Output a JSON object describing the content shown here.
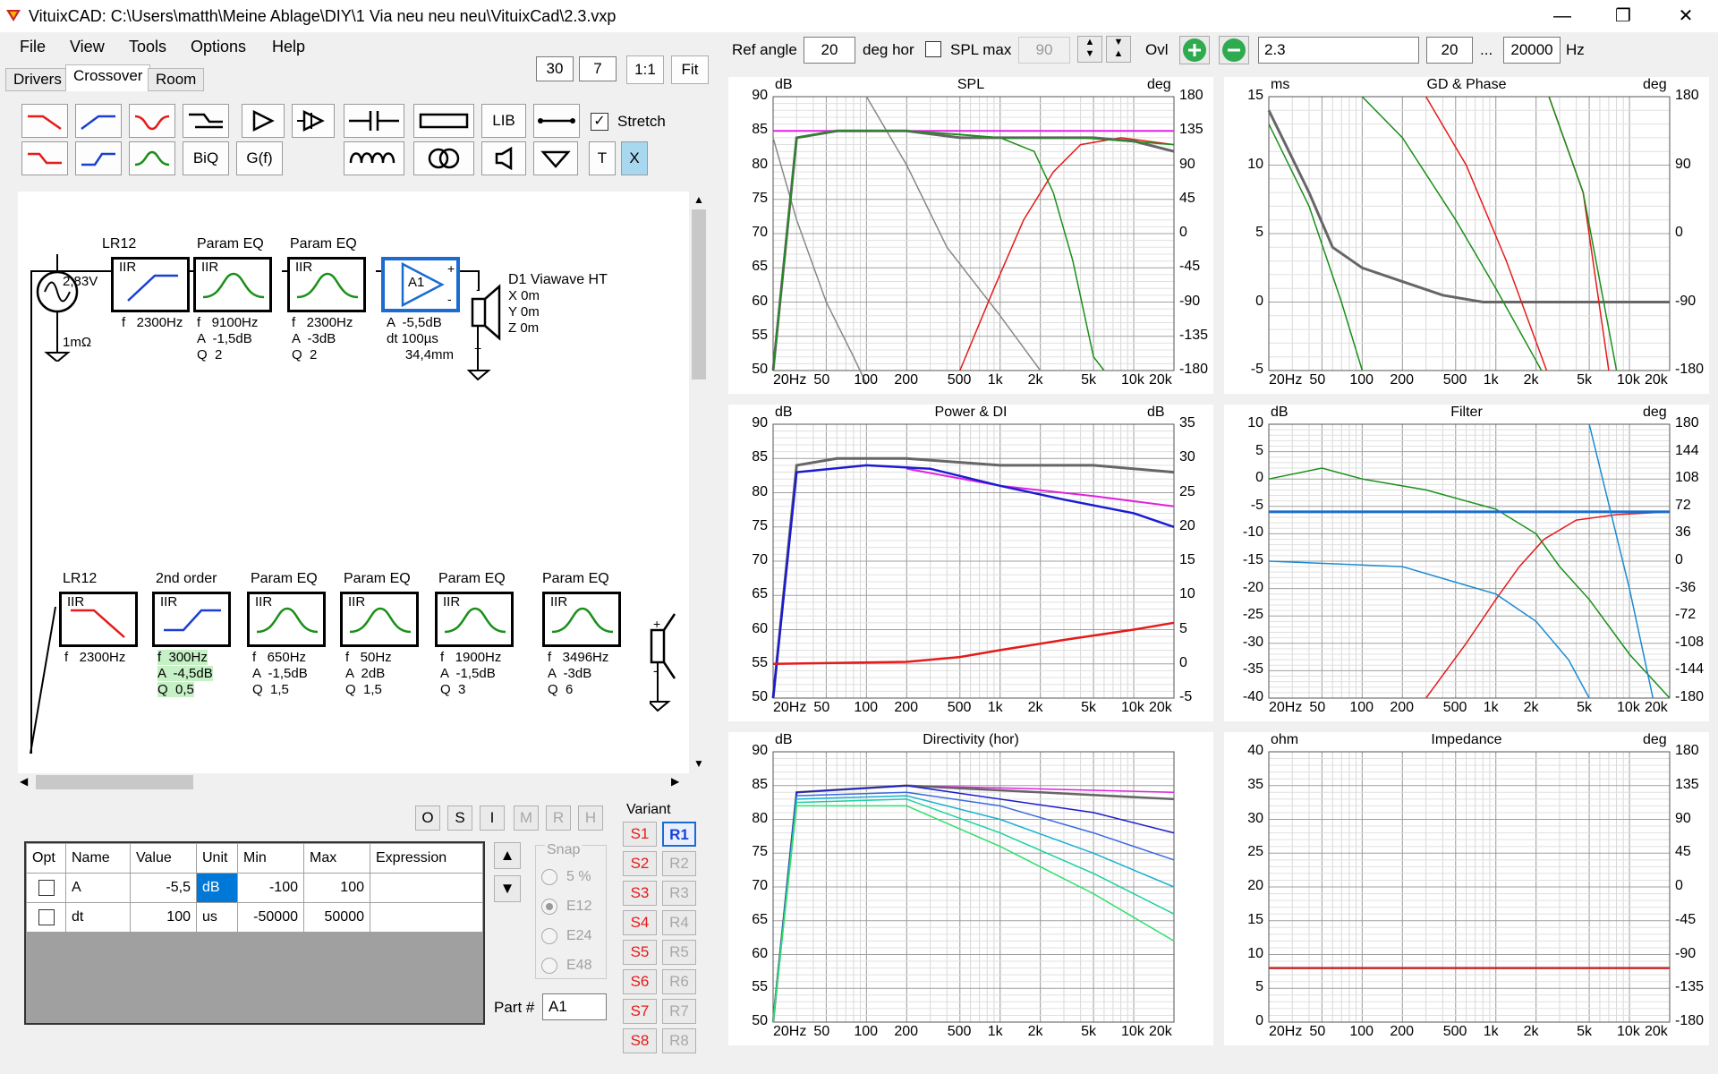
{
  "window": {
    "title": "VituixCAD: C:\\Users\\matth\\Meine Ablage\\DIY\\1 Via neu neu neu\\VituixCad\\2.3.vxp",
    "minimize": "—",
    "restore": "❐",
    "close": "✕"
  },
  "menu": [
    "File",
    "View",
    "Tools",
    "Options",
    "Help"
  ],
  "tabs": [
    "Drivers",
    "Crossover",
    "Room"
  ],
  "zoom": {
    "v1": "30",
    "v2": "7",
    "btn1": "1:1",
    "btn2": "Fit"
  },
  "toolbar": {
    "lib": "LIB",
    "stretch": "Stretch",
    "biq": "BiQ",
    "gf": "G(f)",
    "t": "T",
    "x": "X"
  },
  "top_chain": {
    "source": {
      "voltage": "2,83V",
      "imp": "1mΩ"
    },
    "blocks": [
      {
        "title": "LR12",
        "type": "IIR",
        "params": "f   2300Hz"
      },
      {
        "title": "Param EQ",
        "type": "IIR",
        "params": "f   9100Hz\nA  -1,5dB\nQ  2"
      },
      {
        "title": "Param EQ",
        "type": "IIR",
        "params": "f   2300Hz\nA  -3dB\nQ  2"
      }
    ],
    "amp": {
      "name": "A1",
      "params": "A  -5,5dB\ndt 100µs\n     34,4mm"
    },
    "driver": {
      "name": "D1 Viawave HT",
      "x": "X 0m",
      "y": "Y 0m",
      "z": "Z 0m"
    }
  },
  "bottom_chain": {
    "blocks": [
      {
        "title": "LR12",
        "type": "IIR",
        "params": "f   2300Hz"
      },
      {
        "title": "2nd order",
        "type": "IIR",
        "p1": "f  300Hz",
        "p2": "A  -4,5dB",
        "p3": "Q  0,5"
      },
      {
        "title": "Param EQ",
        "type": "IIR",
        "params": "f   650Hz\nA  -1,5dB\nQ  1,5"
      },
      {
        "title": "Param EQ",
        "type": "IIR",
        "params": "f   50Hz\nA  2dB\nQ  1,5"
      },
      {
        "title": "Param EQ",
        "type": "IIR",
        "params": "f   1900Hz\nA  -1,5dB\nQ  3"
      },
      {
        "title": "Param EQ",
        "type": "IIR",
        "params": "f   3496Hz\nA  -3dB\nQ  6"
      }
    ]
  },
  "small_buttons": [
    "O",
    "S",
    "I",
    "M",
    "R",
    "H"
  ],
  "table": {
    "headers": [
      "Opt",
      "Name",
      "Value",
      "Unit",
      "Min",
      "Max",
      "Expression"
    ],
    "rows": [
      {
        "name": "A",
        "value": "-5,5",
        "unit": "dB",
        "min": "-100",
        "max": "100"
      },
      {
        "name": "dt",
        "value": "100",
        "unit": "us",
        "min": "-50000",
        "max": "50000"
      }
    ]
  },
  "snap": {
    "title": "Snap",
    "options": [
      "5 %",
      "E12",
      "E24",
      "E48"
    ],
    "selected": "E12"
  },
  "part": {
    "label": "Part #",
    "value": "A1"
  },
  "variant": {
    "title": "Variant",
    "s": [
      "S1",
      "S2",
      "S3",
      "S4",
      "S5",
      "S6",
      "S7",
      "S8"
    ],
    "r": [
      "R1",
      "R2",
      "R3",
      "R4",
      "R5",
      "R6",
      "R7",
      "R8"
    ],
    "active": "R1"
  },
  "top_controls": {
    "ref_angle_label": "Ref angle",
    "ref_angle": "20",
    "deg_hor": "deg hor",
    "spl_max": "SPL max",
    "spl_max_val": "90",
    "ovl": "Ovl",
    "name": "2.3",
    "f_min": "20",
    "dots": "...",
    "f_max": "20000",
    "hz": "Hz"
  },
  "plots": [
    {
      "title": "SPL",
      "lu": "dB",
      "ru": "deg",
      "yl": [
        "90",
        "85",
        "80",
        "75",
        "70",
        "65",
        "60",
        "55",
        "50"
      ],
      "yr": [
        "180",
        "135",
        "90",
        "45",
        "0",
        "-45",
        "-90",
        "-135",
        "-180"
      ]
    },
    {
      "title": "GD & Phase",
      "lu": "ms",
      "ru": "deg",
      "yl": [
        "15",
        "10",
        "5",
        "0",
        "-5"
      ],
      "yr": [
        "180",
        "90",
        "0",
        "-90",
        "-180"
      ]
    },
    {
      "title": "Power & DI",
      "lu": "dB",
      "ru": "dB",
      "yl": [
        "90",
        "85",
        "80",
        "75",
        "70",
        "65",
        "60",
        "55",
        "50"
      ],
      "yr": [
        "35",
        "30",
        "25",
        "20",
        "15",
        "10",
        "5",
        "0",
        "-5"
      ]
    },
    {
      "title": "Filter",
      "lu": "dB",
      "ru": "deg",
      "yl": [
        "10",
        "5",
        "0",
        "-5",
        "-10",
        "-15",
        "-20",
        "-25",
        "-30",
        "-35",
        "-40"
      ],
      "yr": [
        "180",
        "144",
        "108",
        "72",
        "36",
        "0",
        "-36",
        "-72",
        "-108",
        "-144",
        "-180"
      ]
    },
    {
      "title": "Directivity (hor)",
      "lu": "dB",
      "ru": "",
      "yl": [
        "90",
        "85",
        "80",
        "75",
        "70",
        "65",
        "60",
        "55",
        "50"
      ],
      "yr": []
    },
    {
      "title": "Impedance",
      "lu": "ohm",
      "ru": "deg",
      "yl": [
        "40",
        "35",
        "30",
        "25",
        "20",
        "15",
        "10",
        "5",
        "0"
      ],
      "yr": [
        "180",
        "135",
        "90",
        "45",
        "0",
        "-45",
        "-90",
        "-135",
        "-180"
      ]
    }
  ],
  "xticks": [
    "20Hz",
    "50",
    "100",
    "200",
    "500",
    "1k",
    "2k",
    "5k",
    "10k",
    "20k"
  ]
}
